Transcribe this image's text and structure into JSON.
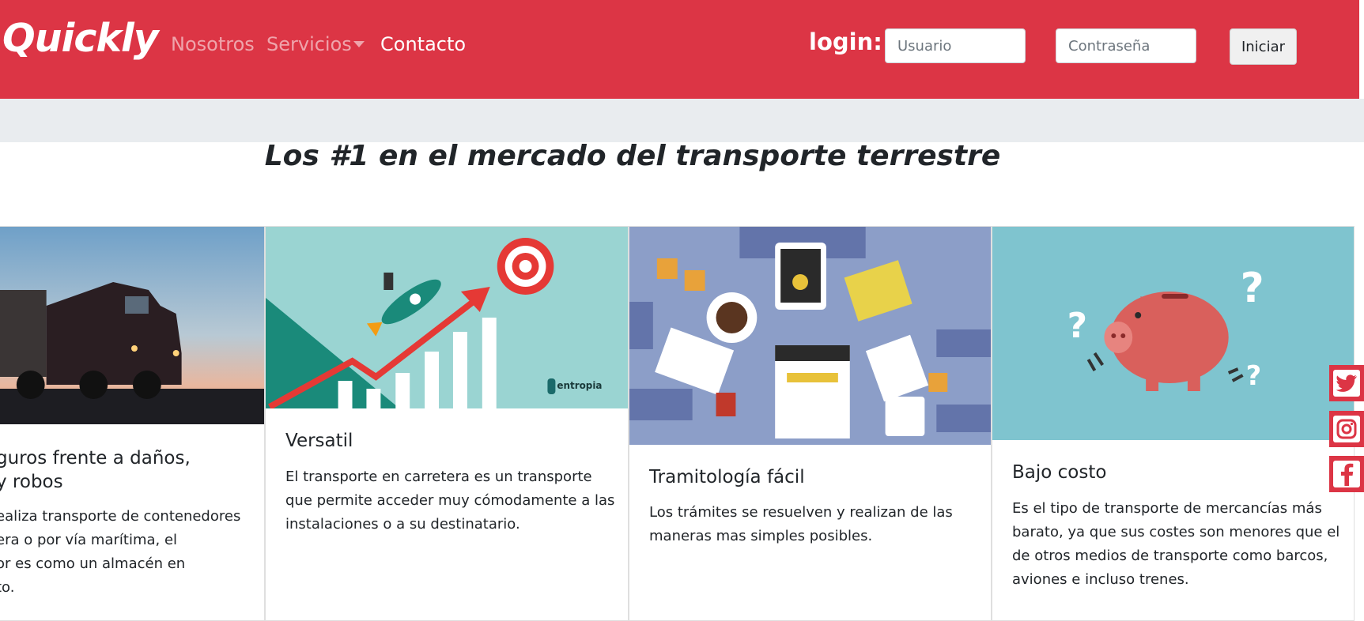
{
  "navbar": {
    "brand": "Quickly",
    "links": [
      {
        "label": "Nosotros"
      },
      {
        "label": "Servicios"
      },
      {
        "label": "Contacto"
      }
    ],
    "login_label": "login:",
    "username_placeholder": "Usuario",
    "password_placeholder": "Contraseña",
    "submit_label": "Iniciar"
  },
  "headline": "Los #1 en el mercado del transporte terrestre",
  "cards": [
    {
      "title": "guros frente a daños,\ny robos",
      "text": "ealiza transporte de contenedores\nera o por vía marítima, el\nor es como un almacén en\nto.",
      "image": "truck-sunset"
    },
    {
      "title": "Versatil",
      "text": "El transporte en carretera es un transporte que permite acceder muy cómodamente a las instalaciones o a su destinatario.",
      "image": "rocket-growth",
      "image_caption": "entropia"
    },
    {
      "title": "Tramitología fácil",
      "text": "Los trámites se resuelven y realizan de las maneras mas simples posibles.",
      "image": "desk-paperwork"
    },
    {
      "title": "Bajo costo",
      "text": "Es el tipo de transporte de mercancías más barato, ya que sus costes son menores que el de otros medios de transporte como barcos, aviones e incluso trenes.",
      "image": "piggy-bank"
    }
  ],
  "social": [
    "twitter-icon",
    "instagram-icon",
    "facebook-icon"
  ],
  "colors": {
    "primary": "#dc3545",
    "band": "#e9ecef"
  }
}
